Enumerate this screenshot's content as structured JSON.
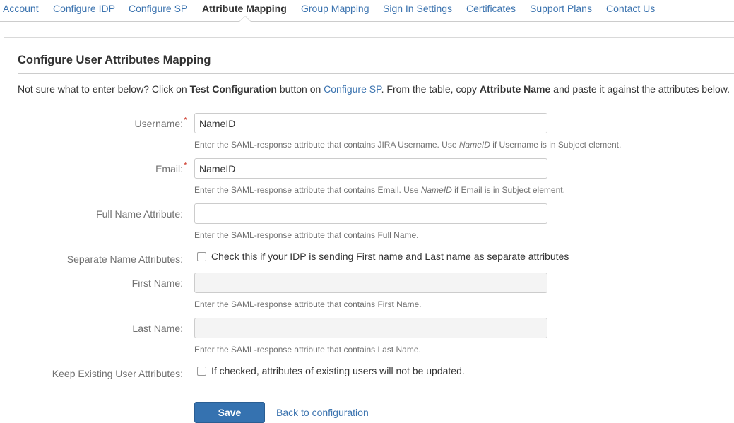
{
  "nav": {
    "items": [
      {
        "label": "Account"
      },
      {
        "label": "Configure IDP"
      },
      {
        "label": "Configure SP"
      },
      {
        "label": "Attribute Mapping"
      },
      {
        "label": "Group Mapping"
      },
      {
        "label": "Sign In Settings"
      },
      {
        "label": "Certificates"
      },
      {
        "label": "Support Plans"
      },
      {
        "label": "Contact Us"
      }
    ],
    "active": "Attribute Mapping"
  },
  "page": {
    "title": "Configure User Attributes Mapping",
    "intro": {
      "part1": "Not sure what to enter below? Click on ",
      "bold1": "Test Configuration",
      "part2": " button on ",
      "link": "Configure SP",
      "part3": ". From the table, copy ",
      "bold2": "Attribute Name",
      "part4": " and paste it against the attributes below."
    }
  },
  "form": {
    "required_mark": "*",
    "username": {
      "label": "Username:",
      "value": "NameID",
      "desc_pre": "Enter the SAML-response attribute that contains JIRA Username. Use ",
      "desc_em": "NameID",
      "desc_post": " if Username is in Subject element."
    },
    "email": {
      "label": "Email:",
      "value": "NameID",
      "desc_pre": "Enter the SAML-response attribute that contains Email. Use ",
      "desc_em": "NameID",
      "desc_post": " if Email is in Subject element."
    },
    "full_name": {
      "label": "Full Name Attribute:",
      "value": "",
      "desc": "Enter the SAML-response attribute that contains Full Name."
    },
    "separate_names": {
      "label": "Separate Name Attributes:",
      "checkbox_text": "Check this if your IDP is sending First name and Last name as separate attributes",
      "checked": false
    },
    "first_name": {
      "label": "First Name:",
      "value": "",
      "desc": "Enter the SAML-response attribute that contains First Name."
    },
    "last_name": {
      "label": "Last Name:",
      "value": "",
      "desc": "Enter the SAML-response attribute that contains Last Name."
    },
    "keep_existing": {
      "label": "Keep Existing User Attributes:",
      "checkbox_text": "If checked, attributes of existing users will not be updated.",
      "checked": false
    },
    "save_label": "Save",
    "back_label": "Back to configuration"
  },
  "colors": {
    "link": "#3b73af",
    "button": "#3572b0",
    "required": "#d04437"
  }
}
